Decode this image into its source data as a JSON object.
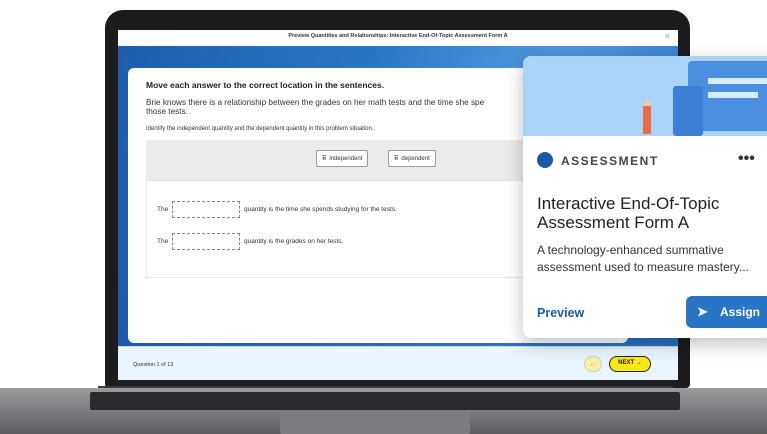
{
  "window": {
    "title": "Preview Quantities and Relationships: Interactive End-Of-Topic Assessment Form A",
    "close": "×"
  },
  "question": {
    "prompt": "Move each answer to the correct location in the sentences.",
    "text": "Brie knows there is a relationship between the grades on her math tests and the time she spe",
    "text_cont": "those tests.",
    "instruction": "Identify the independent quantity and the dependent quantity in this problem situation.",
    "chips": [
      "independent",
      "dependent"
    ],
    "sentence1_pre": "The",
    "sentence1_post": "quantity is the time she spends studying for the tests.",
    "sentence2_pre": "The",
    "sentence2_post": "quantity is the grades on her tests."
  },
  "footer": {
    "counter": "Question 1 of 13",
    "prev_icon": "←",
    "next_label": "NEXT →"
  },
  "card": {
    "tag": "ASSESSMENT",
    "more": "•••",
    "title": "Interactive End-Of-Topic Assessment Form A",
    "description": "A technology-enhanced summative assessment used to measure mastery...",
    "preview_label": "Preview",
    "assign_label": "Assign",
    "assign_icon": "➤"
  },
  "colors": {
    "accent": "#2a74c6",
    "next": "#f7e81a"
  }
}
